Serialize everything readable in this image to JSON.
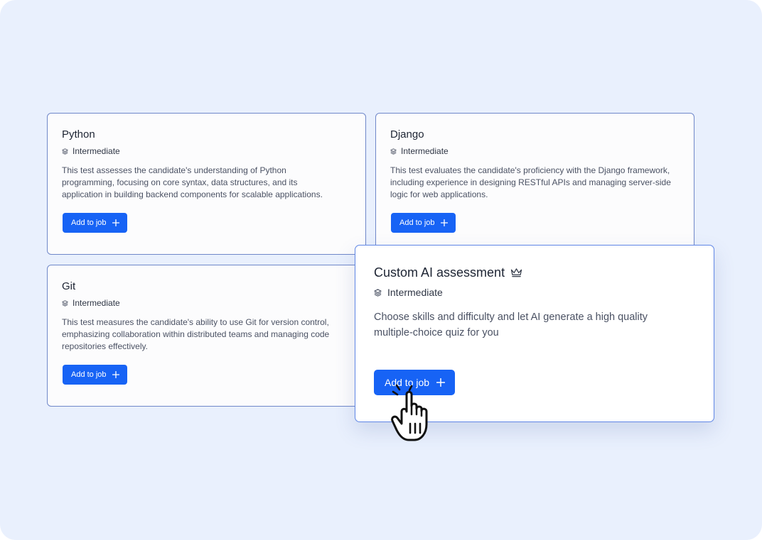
{
  "cards": [
    {
      "title": "Python",
      "level": "Intermediate",
      "description": "This test assesses the candidate's understanding of Python programming, focusing on core syntax, data structures, and its application in building backend components for scalable applications.",
      "button_label": "Add to job"
    },
    {
      "title": "Django",
      "level": "Intermediate",
      "description": "This test evaluates the candidate's proficiency with the Django framework, including experience in designing RESTful APIs and managing server-side logic for web applications.",
      "button_label": "Add to job"
    },
    {
      "title": "Git",
      "level": "Intermediate",
      "description": "This test measures the candidate's ability to use Git for version control, emphasizing collaboration within distributed teams and managing code repositories effectively.",
      "button_label": "Add to job"
    }
  ],
  "featured": {
    "title": "Custom AI assessment",
    "level": "Intermediate",
    "description": "Choose skills and difficulty and let AI generate a high quality multiple-choice quiz for you",
    "button_label": "Add to job",
    "title_icon": "crown-icon"
  },
  "icons": {
    "level": "layers-icon",
    "add": "plus-icon",
    "pointer": "hand-pointer-icon"
  },
  "colors": {
    "background": "#e9f0fd",
    "primary": "#1763f5",
    "card_border": "#6f87c9",
    "text": "#1d2433"
  }
}
